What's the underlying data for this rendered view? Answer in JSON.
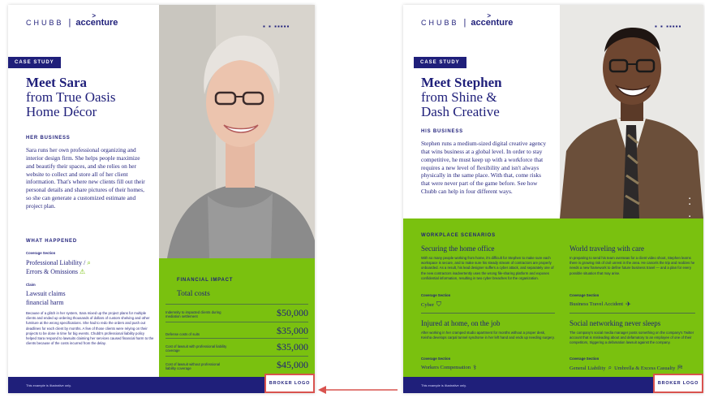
{
  "brand": {
    "chubb": "CHUBB",
    "separator": "|",
    "accenture": "accenture",
    "caret": ">"
  },
  "nav_dots": "▪ ▪    ▪▪▪▪▪",
  "colors": {
    "navy": "#1f1f7a",
    "green": "#7ac10f",
    "highlight": "#d9534f"
  },
  "left": {
    "badge": "CASE STUDY",
    "title_bold": "Meet Sara",
    "title_line2": "from True Oasis",
    "title_line3": "Home Décor",
    "her_business_label": "HER BUSINESS",
    "her_business_text": "Sara runs her own professional organizing and interior design firm. She helps people maximize and beautify their spaces, and she relies on her website to collect and store all of her client information. That's where new clients fill out their personal details and share pictures of their homes, so she can generate a customized estimate and project plan.",
    "what_happened_label": "WHAT HAPPENED",
    "coverage_section_label": "Coverage Section",
    "coverage_line1": "Professional Liability /",
    "coverage_line2": "Errors & Omissions",
    "claim_label": "Claim",
    "claim_line1": "Lawsuit claims",
    "claim_line2": "financial harm",
    "story": "Because of a glitch in her system, Sara mixed up the project plans for multiple clients and ended up ordering thousands of dollars of custom shelving and other furniture at the wrong specifications. She had to redo the orders and push out deadlines for each client by months. A few of those clients were relying on their projects to be done in time for big events. Chubb's professional liability policy helped Sara respond to lawsuits claiming her services caused financial harm to the clients because of the costs incurred from the delay.",
    "financial_impact_label": "FINANCIAL IMPACT",
    "total_costs": "Total costs",
    "fin_rows": [
      {
        "label": "Indemnity to impacted clients during mediation settlement",
        "amount": "$50,000"
      },
      {
        "label": "Defense costs of suits",
        "amount": "$35,000"
      },
      {
        "label": "Cost of lawsuit with professional liability coverage",
        "amount": "$35,000"
      },
      {
        "label": "Cost of lawsuit without professional liability coverage",
        "amount": "$45,000"
      }
    ],
    "footer_note": "This example is illustrative only.",
    "broker_logo": "BROKER LOGO"
  },
  "right": {
    "badge": "CASE STUDY",
    "title_bold": "Meet Stephen",
    "title_line2": "from Shine &",
    "title_line3": "Dash Creative",
    "his_business_label": "HIS BUSINESS",
    "his_business_text": "Stephen runs a medium-sized digital creative agency that wins business at a global level. In order to stay competitive, he must keep up with a workforce that requires a new level of flexibility and isn't always physically in the same place. With that, come risks that were never part of the game before. See how Chubb can help in four different ways.",
    "scenarios_label": "WORKPLACE SCENARIOS",
    "coverage_section_label": "Coverage Section",
    "scenarios": [
      {
        "title": "Securing the home office",
        "body": "With so many people working from home, it's difficult for Stephen to make sure each workspace is secure, and to make sure his steady stream of contractors are properly onboarded. As a result, his lead designer suffers a cyber attack, and separately one of the new contractors inadvertently uses the wrong file-sharing platform and exposes confidential information, resulting in two cyber breaches for the organization.",
        "coverage": "Cyber",
        "icon": "shield-icon",
        "glyph": "⛉"
      },
      {
        "title": "World traveling with care",
        "body": "In preparing to send his team overseas for a client video shoot, Stephen learns there is growing risk of civil unrest in the area. He cancels the trip and realizes he needs a new framework to define future business travel — and a plan for every possible situation that may arise.",
        "coverage": "Business Travel Accident",
        "icon": "plane-icon",
        "glyph": "✈"
      },
      {
        "title": "Injured at home, on the job",
        "body": "After working in her cramped studio apartment for months without a proper desk, Keisha develops carpal tunnel syndrome in her left hand and ends up needing surgery.",
        "coverage": "Workers Compensation",
        "icon": "medical-icon",
        "glyph": "⚕"
      },
      {
        "title": "Social networking never sleeps",
        "body": "The company's social media manager posts something on the company's Twitter account that is misleading about and defamatory to an employee of one of their competitors, triggering a defamation lawsuit against the company.",
        "coverage": "General Liability",
        "coverage2": "Umbrella & Excess Casualty",
        "icon": "search-icon",
        "glyph": "⌕",
        "glyph2": "⛿"
      }
    ],
    "footer_note": "This example is illustrative only.",
    "broker_logo": "BROKER LOGO"
  }
}
